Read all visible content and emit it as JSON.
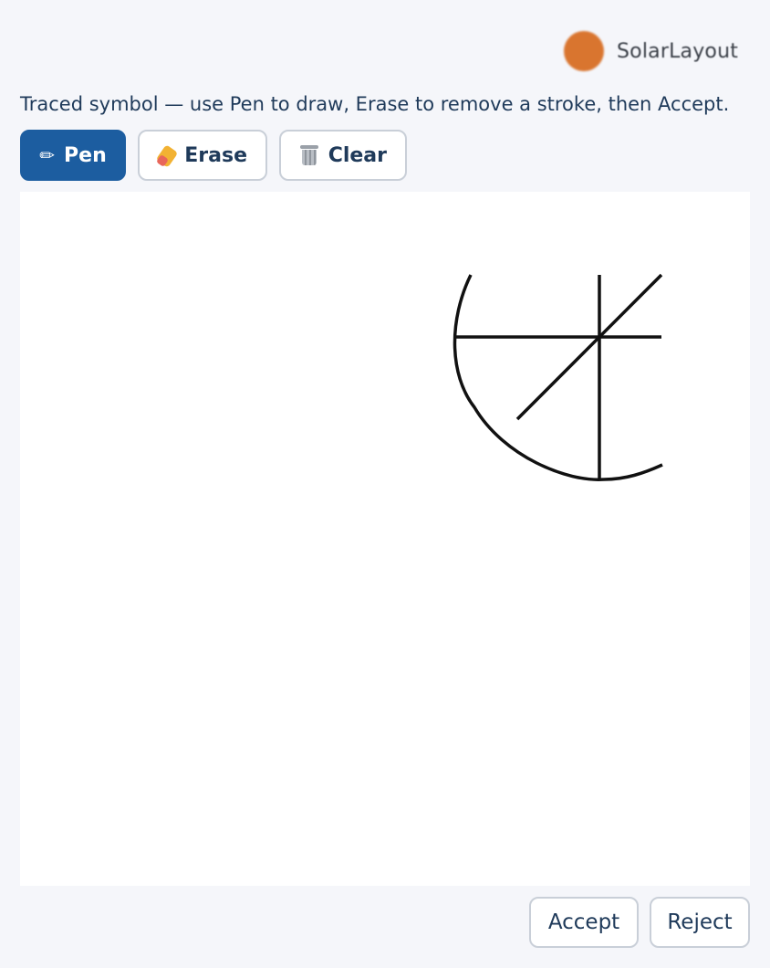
{
  "brand": {
    "name": "SolarLayout",
    "logo_color": "#d9752f"
  },
  "instructions": "Traced symbol — use Pen to draw, Erase to remove a stroke, then Accept.",
  "toolbar": {
    "pen_label": "Pen",
    "pen_icon": "pencil-icon",
    "erase_label": "Erase",
    "erase_icon": "sponge-eraser-icon",
    "clear_label": "Clear",
    "clear_icon": "wastebasket-icon",
    "active_tool": "Pen",
    "accent_color": "#1c5da0"
  },
  "actions": {
    "accept_label": "Accept",
    "reject_label": "Reject"
  },
  "drawing": {
    "stroke_color": "#111111",
    "stroke_count": 4
  }
}
